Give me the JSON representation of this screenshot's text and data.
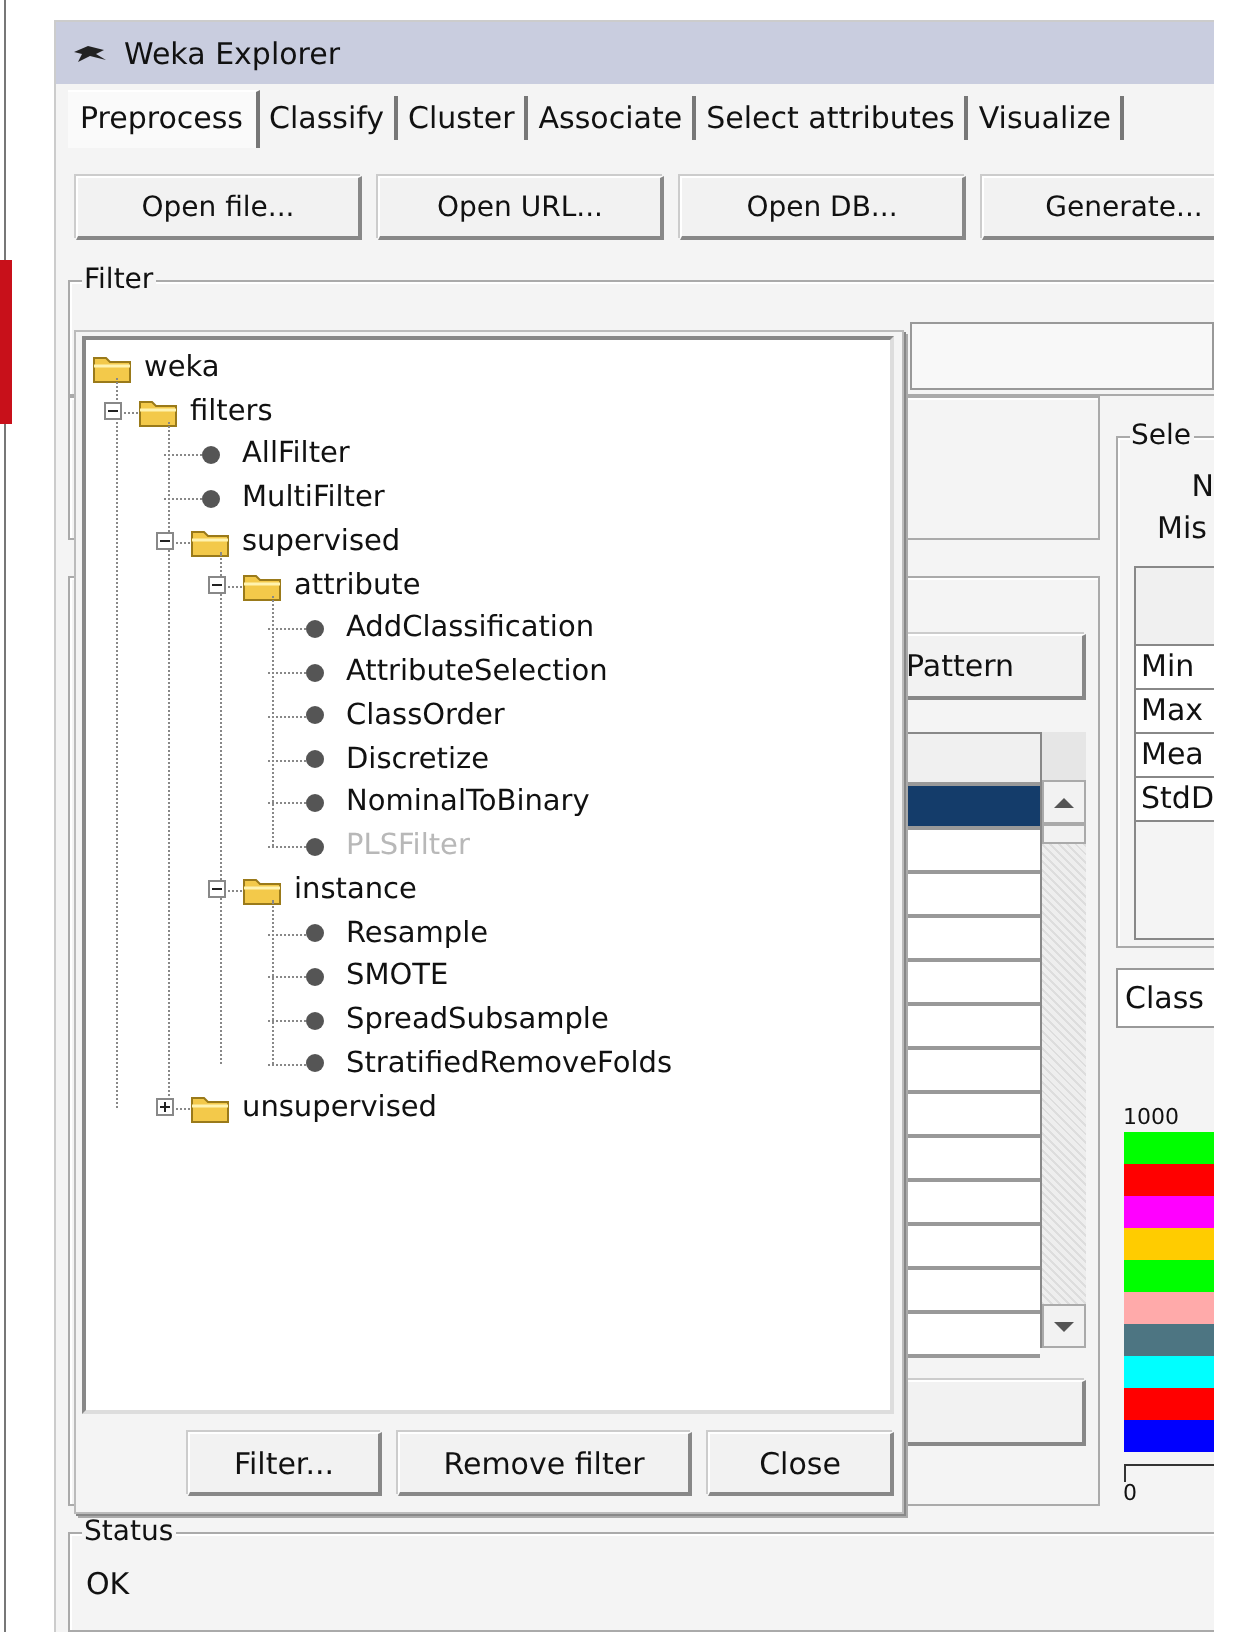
{
  "window": {
    "title": "Weka Explorer"
  },
  "tabs": [
    {
      "label": "Preprocess",
      "selected": true
    },
    {
      "label": "Classify",
      "selected": false
    },
    {
      "label": "Cluster",
      "selected": false
    },
    {
      "label": "Associate",
      "selected": false
    },
    {
      "label": "Select attributes",
      "selected": false
    },
    {
      "label": "Visualize",
      "selected": false
    }
  ],
  "toolbar_buttons": [
    "Open file...",
    "Open URL...",
    "Open DB...",
    "Generate..."
  ],
  "filter_group": {
    "label": "Filter"
  },
  "attributes": {
    "pattern_button": "Pattern",
    "rows": [
      {
        "selected": true
      },
      {
        "selected": false
      },
      {
        "selected": false
      },
      {
        "selected": false
      },
      {
        "selected": false
      },
      {
        "selected": false
      },
      {
        "selected": false
      },
      {
        "selected": false
      },
      {
        "selected": false
      },
      {
        "selected": false
      },
      {
        "selected": false
      },
      {
        "selected": false
      },
      {
        "selected": false
      }
    ]
  },
  "selected_attribute": {
    "label": "Sele",
    "lines": [
      "N",
      "Mis"
    ],
    "stats": [
      "Min",
      "Max",
      "Mea",
      "StdD"
    ]
  },
  "class_selector": {
    "value": "Class"
  },
  "histogram": {
    "top_label": "1000",
    "bottom_label": "0",
    "bars": [
      {
        "color": "#00ff00"
      },
      {
        "color": "#ff0000"
      },
      {
        "color": "#ff00ff"
      },
      {
        "color": "#ffcc00"
      },
      {
        "color": "#00ff00"
      },
      {
        "color": "#ffaaaa"
      },
      {
        "color": "#4d7582"
      },
      {
        "color": "#00ffff"
      },
      {
        "color": "#ff0000"
      },
      {
        "color": "#0000ff"
      }
    ]
  },
  "status": {
    "label": "Status",
    "text": "OK"
  },
  "filter_dialog": {
    "tree": {
      "label": "weka",
      "kind": "folder",
      "children": [
        {
          "label": "filters",
          "kind": "folder",
          "expanded": true,
          "children": [
            {
              "label": "AllFilter",
              "kind": "leaf",
              "disabled": false
            },
            {
              "label": "MultiFilter",
              "kind": "leaf",
              "disabled": false
            },
            {
              "label": "supervised",
              "kind": "folder",
              "expanded": true,
              "children": [
                {
                  "label": "attribute",
                  "kind": "folder",
                  "expanded": true,
                  "children": [
                    {
                      "label": "AddClassification",
                      "kind": "leaf",
                      "disabled": false
                    },
                    {
                      "label": "AttributeSelection",
                      "kind": "leaf",
                      "disabled": false
                    },
                    {
                      "label": "ClassOrder",
                      "kind": "leaf",
                      "disabled": false
                    },
                    {
                      "label": "Discretize",
                      "kind": "leaf",
                      "disabled": false
                    },
                    {
                      "label": "NominalToBinary",
                      "kind": "leaf",
                      "disabled": false
                    },
                    {
                      "label": "PLSFilter",
                      "kind": "leaf",
                      "disabled": true
                    }
                  ]
                },
                {
                  "label": "instance",
                  "kind": "folder",
                  "expanded": true,
                  "children": [
                    {
                      "label": "Resample",
                      "kind": "leaf",
                      "disabled": false
                    },
                    {
                      "label": "SMOTE",
                      "kind": "leaf",
                      "disabled": false
                    },
                    {
                      "label": "SpreadSubsample",
                      "kind": "leaf",
                      "disabled": false
                    },
                    {
                      "label": "StratifiedRemoveFolds",
                      "kind": "leaf",
                      "disabled": false
                    }
                  ]
                }
              ]
            },
            {
              "label": "unsupervised",
              "kind": "folder",
              "expanded": false
            }
          ]
        }
      ]
    },
    "buttons": [
      "Filter...",
      "Remove filter",
      "Close"
    ]
  }
}
